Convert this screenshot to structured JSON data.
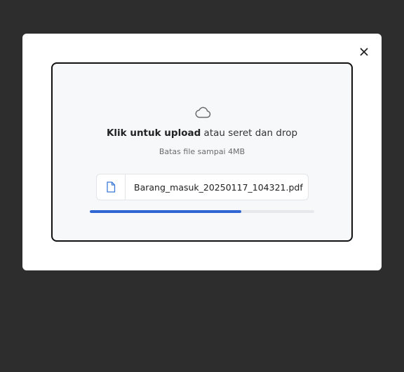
{
  "dialog": {
    "close_icon": "close-icon",
    "dropzone": {
      "icon": "cloud-icon",
      "primary_bold": "Klik untuk upload",
      "primary_rest": " atau seret dan drop",
      "hint": "Batas file sampai 4MB"
    },
    "file": {
      "icon": "file-icon",
      "name": "Barang_masuk_20250117_104321.pdf",
      "progress": 0.675
    }
  },
  "colors": {
    "backdrop": "#2d2d2d",
    "accent": "#2f66d4",
    "icon_blue": "#3a78d8"
  }
}
